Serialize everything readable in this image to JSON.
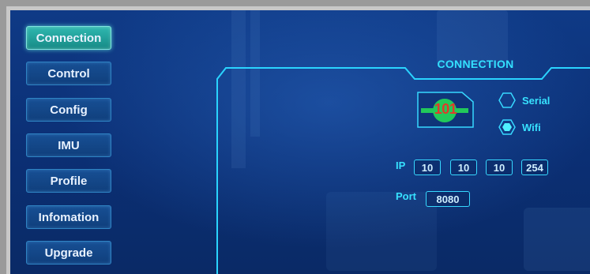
{
  "nav": {
    "items": [
      {
        "label": "Connection",
        "active": true
      },
      {
        "label": "Control",
        "active": false
      },
      {
        "label": "Config",
        "active": false
      },
      {
        "label": "IMU",
        "active": false
      },
      {
        "label": "Profile",
        "active": false
      },
      {
        "label": "Infomation",
        "active": false
      },
      {
        "label": "Upgrade",
        "active": false
      }
    ]
  },
  "panel": {
    "title": "CONNECTION",
    "logo_text": "101",
    "mode_options": [
      {
        "label": "Serial",
        "selected": false
      },
      {
        "label": "Wifi",
        "selected": true
      }
    ],
    "ip_label": "IP",
    "ip": [
      "10",
      "10",
      "10",
      "254"
    ],
    "port_label": "Port",
    "port": "8080"
  },
  "colors": {
    "accent": "#37e2ff",
    "active_tab": "#2fb8b0",
    "logo_green": "#22c95a",
    "logo_red": "#e23a2a"
  }
}
